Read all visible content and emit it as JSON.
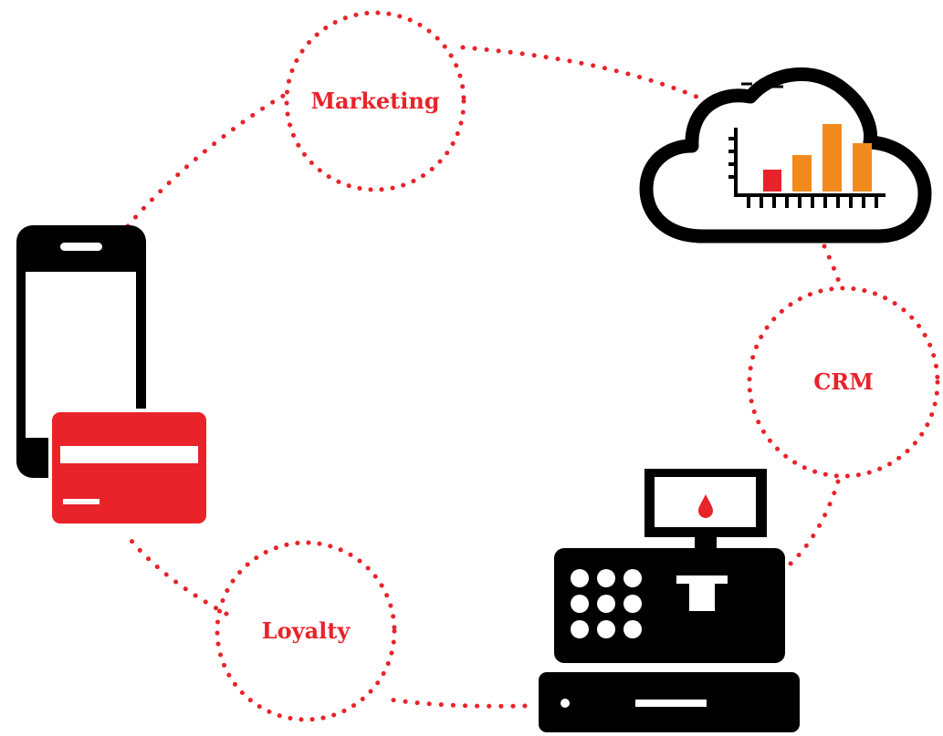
{
  "colors": {
    "accent": "#e8232a",
    "ink": "#000000",
    "bar_orange": "#f28a1e",
    "bar_red": "#e8232a",
    "background": "#ffffff"
  },
  "labels": {
    "marketing": "Marketing",
    "crm": "CRM",
    "loyalty": "Loyalty"
  },
  "icons": {
    "phone": "smartphone-icon",
    "card": "credit-card-icon",
    "cloud": "cloud-analytics-icon",
    "register": "cash-register-icon"
  },
  "cloud_chart": {
    "bar_count": 4,
    "bar_values": [
      2,
      3,
      6,
      4
    ],
    "bar_colors": [
      "#e8232a",
      "#f28a1e",
      "#f28a1e",
      "#f28a1e"
    ]
  }
}
